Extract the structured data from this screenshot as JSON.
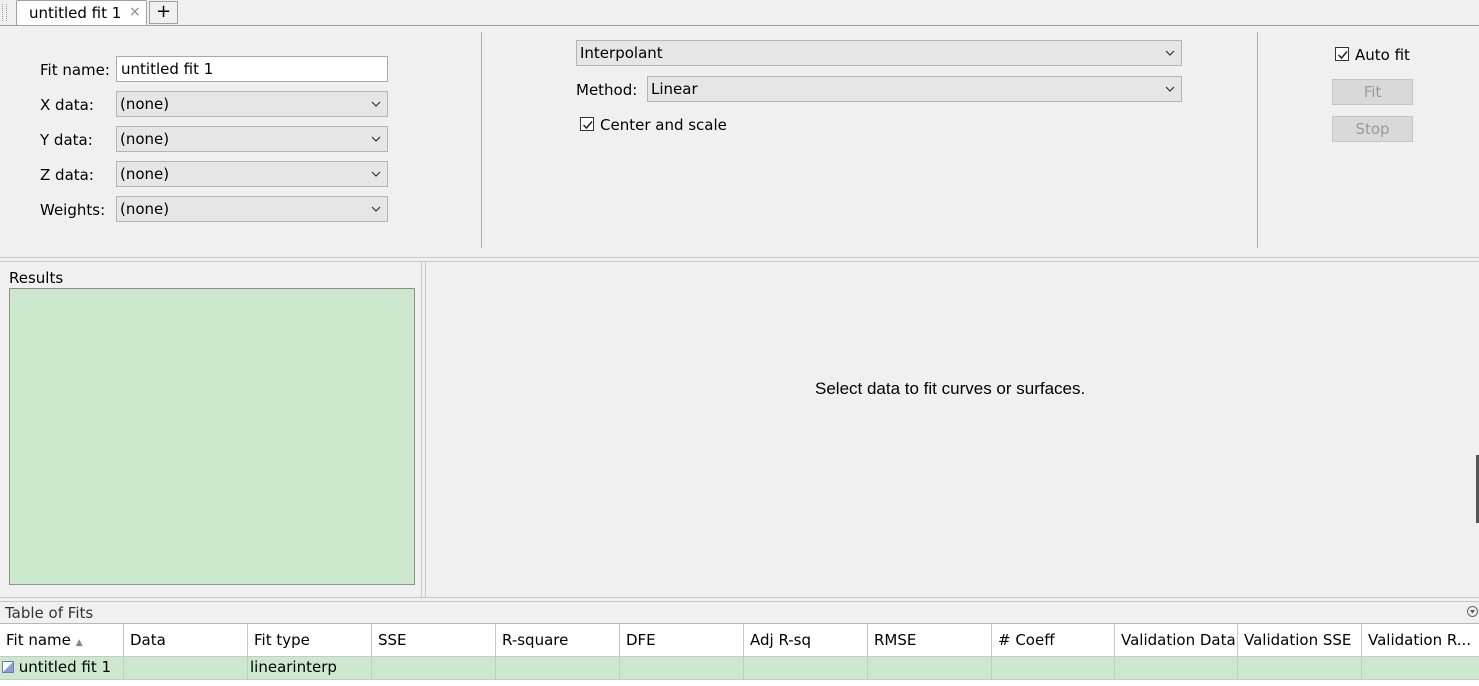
{
  "tabs": {
    "active_label": "untitled fit 1",
    "close_glyph": "×",
    "add_glyph": "+"
  },
  "fit": {
    "name_label": "Fit name:",
    "name_value": "untitled fit 1",
    "x_label": "X data:",
    "x_value": "(none)",
    "y_label": "Y data:",
    "y_value": "(none)",
    "z_label": "Z data:",
    "z_value": "(none)",
    "weights_label": "Weights:",
    "weights_value": "(none)"
  },
  "model": {
    "type_value": "Interpolant",
    "method_label": "Method:",
    "method_value": "Linear",
    "center_scale_label": "Center and scale",
    "center_scale_checked": true
  },
  "actions": {
    "auto_fit_label": "Auto fit",
    "auto_fit_checked": true,
    "fit_label": "Fit",
    "stop_label": "Stop"
  },
  "results": {
    "title": "Results",
    "bg_color": "#cce8cf"
  },
  "plot": {
    "message": "Select data to fit curves or surfaces."
  },
  "table_of_fits": {
    "title": "Table of Fits",
    "sort_indicator": "▲",
    "columns": [
      "Fit name",
      "Data",
      "Fit type",
      "SSE",
      "R-square",
      "DFE",
      "Adj R-sq",
      "RMSE",
      "# Coeff",
      "Validation Data",
      "Validation SSE",
      "Validation R..."
    ],
    "rows": [
      [
        "untitled fit 1",
        "",
        "linearinterp",
        "",
        "",
        "",
        "",
        "",
        "",
        "",
        "",
        ""
      ]
    ]
  }
}
